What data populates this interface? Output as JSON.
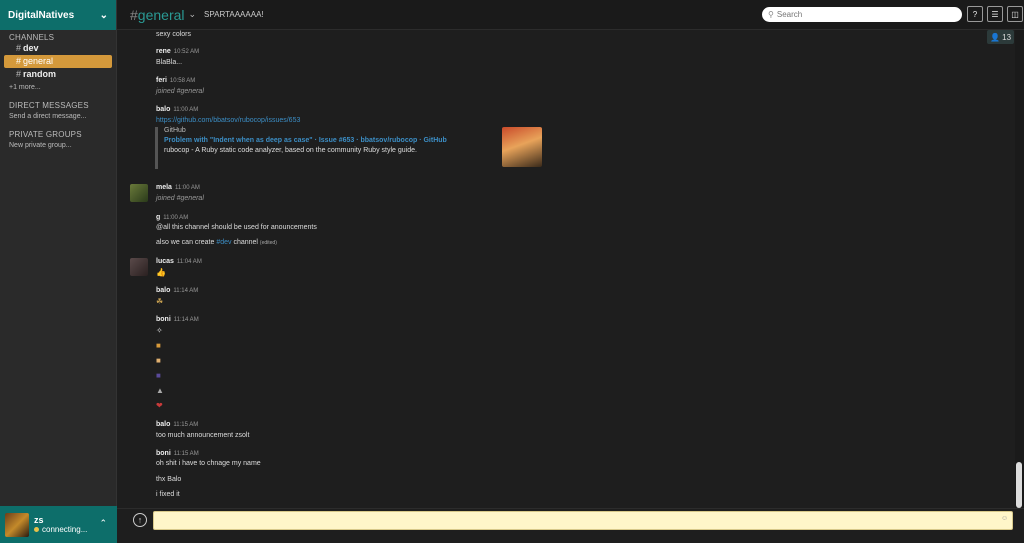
{
  "sidebar": {
    "team_name": "DigitalNatives",
    "channels_header": "CHANNELS",
    "channels": [
      {
        "label": "dev"
      },
      {
        "label": "general"
      },
      {
        "label": "random"
      }
    ],
    "more": "+1 more...",
    "dm_header": "DIRECT MESSAGES",
    "dm_link": "Send a direct message...",
    "pg_header": "PRIVATE GROUPS",
    "pg_link": "New private group...",
    "user": {
      "name": "zs",
      "status": "connecting..."
    }
  },
  "header": {
    "channel": "general",
    "topic": "SPARTAAAAAA!",
    "search_placeholder": "Search",
    "help": "?"
  },
  "members_count": "13",
  "messages": [
    {
      "text": "sexy colors"
    },
    {
      "author": "rene",
      "time": "10:52 AM",
      "text": "BlaBla..."
    },
    {
      "author": "feri",
      "time": "10:58 AM",
      "text": "joined #general"
    },
    {
      "author": "balo",
      "time": "11:00 AM",
      "link": "https://github.com/bbatsov/rubocop/issues/653",
      "attachment": {
        "source": "GitHub",
        "title": "Problem with \"Indent when as deep as case\" · Issue #653 · bbatsov/rubocop · GitHub",
        "desc": "rubocop - A Ruby static code analyzer, based on the community Ruby style guide."
      }
    },
    {
      "author": "mela",
      "time": "11:00 AM",
      "text": "joined #general"
    },
    {
      "author": "g",
      "time": "11:00 AM",
      "text": "@all this channel should be used for anouncements",
      "text2_pre": "also we can create ",
      "text2_link": "#dev",
      "text2_post": " channel ",
      "edited": "(edited)"
    },
    {
      "author": "lucas",
      "time": "11:04 AM"
    },
    {
      "author": "balo",
      "time": "11:14 AM"
    },
    {
      "author": "boni",
      "time": "11:14 AM"
    },
    {
      "author": "balo",
      "time": "11:15 AM",
      "text": "too much announcement zsolt"
    },
    {
      "author": "boni",
      "time": "11:15 AM",
      "text": "oh shit i have to chnage my name",
      "text2": "thx Balo",
      "text3": "i fixed it"
    }
  ]
}
